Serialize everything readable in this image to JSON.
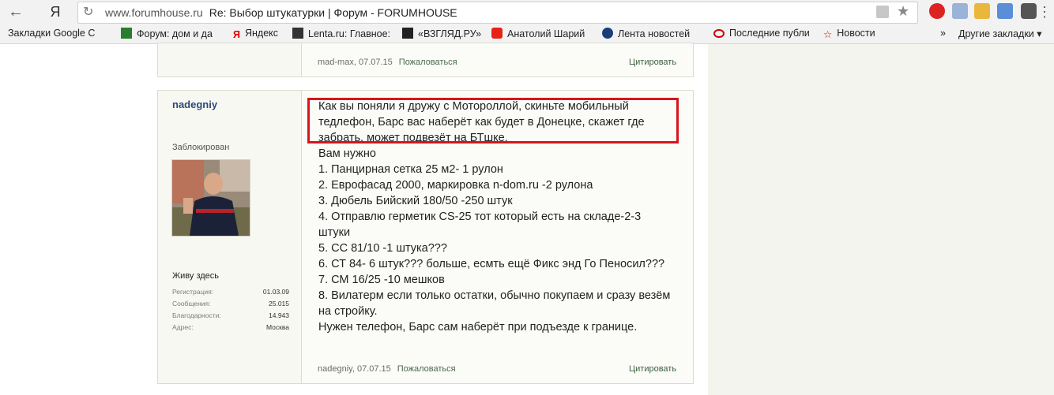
{
  "browser": {
    "back_icon": "back-arrow-icon",
    "yandex_logo": "Я",
    "url": "www.forumhouse.ru",
    "page_title": "Re: Выбор штукатурки | Форум - FORUMHOUSE"
  },
  "bookmarks": [
    {
      "label": "Закладки Google С",
      "icon": "none"
    },
    {
      "label": "Форум: дом и да",
      "icon": "forumhouse-icon"
    },
    {
      "label": "Яндекс",
      "icon": "yandex-icon"
    },
    {
      "label": "Lenta.ru: Главное:",
      "icon": "lenta-icon"
    },
    {
      "label": "«ВЗГЛЯД.РУ»",
      "icon": "vzglyad-icon"
    },
    {
      "label": "Анатолий Шарий",
      "icon": "youtube-icon"
    },
    {
      "label": "Лента новостей",
      "icon": "news-icon"
    },
    {
      "label": "Последние публи",
      "icon": "eye-icon"
    },
    {
      "label": "Новости",
      "icon": "star-icon"
    }
  ],
  "other_bookmarks": "Другие закладки",
  "prev_post": {
    "footer_user_date": "mad-max, 07.07.15",
    "report": "Пожаловаться",
    "quote": "Цитировать"
  },
  "post": {
    "username": "nadegniy",
    "status": "Заблокирован",
    "user_title": "Живу здесь",
    "stats": [
      {
        "label": "Регистрация:",
        "value": "01.03.09"
      },
      {
        "label": "Сообщения:",
        "value": "25.015"
      },
      {
        "label": "Благодарности:",
        "value": "14.943"
      },
      {
        "label": "Адрес:",
        "value": "Москва"
      }
    ],
    "lines": [
      "Как вы поняли я дружу с Мотороллой, скиньте мобильный",
      "тедлефон, Барс вас наберёт как будет в Донецке, скажет где",
      "забрать, может подвезёт на БТшке.",
      "Вам нужно",
      "1. Панцирная сетка 25 м2- 1 рулон",
      "2. Еврофасад 2000, маркировка n-dom.ru -2 рулона",
      "3. Дюбель Бийский 180/50 -250 штук",
      "4. Отправлю герметик CS-25 тот который есть на складе-2-3",
      "штуки",
      "5. СС 81/10 -1 штука???",
      "6. СТ 84- 6 штук??? больше, есмть ещё Фикс энд Го Пеносил???",
      "7. СМ 16/25 -10 мешков",
      "8. Вилатерм если только остатки, обычно покупаем и сразу везём",
      "на стройку.",
      "Нужен телефон, Барс сам наберёт при подъезде к границе."
    ],
    "footer_user_date": "nadegniy, 07.07.15",
    "report": "Пожаловаться",
    "quote": "Цитировать"
  }
}
